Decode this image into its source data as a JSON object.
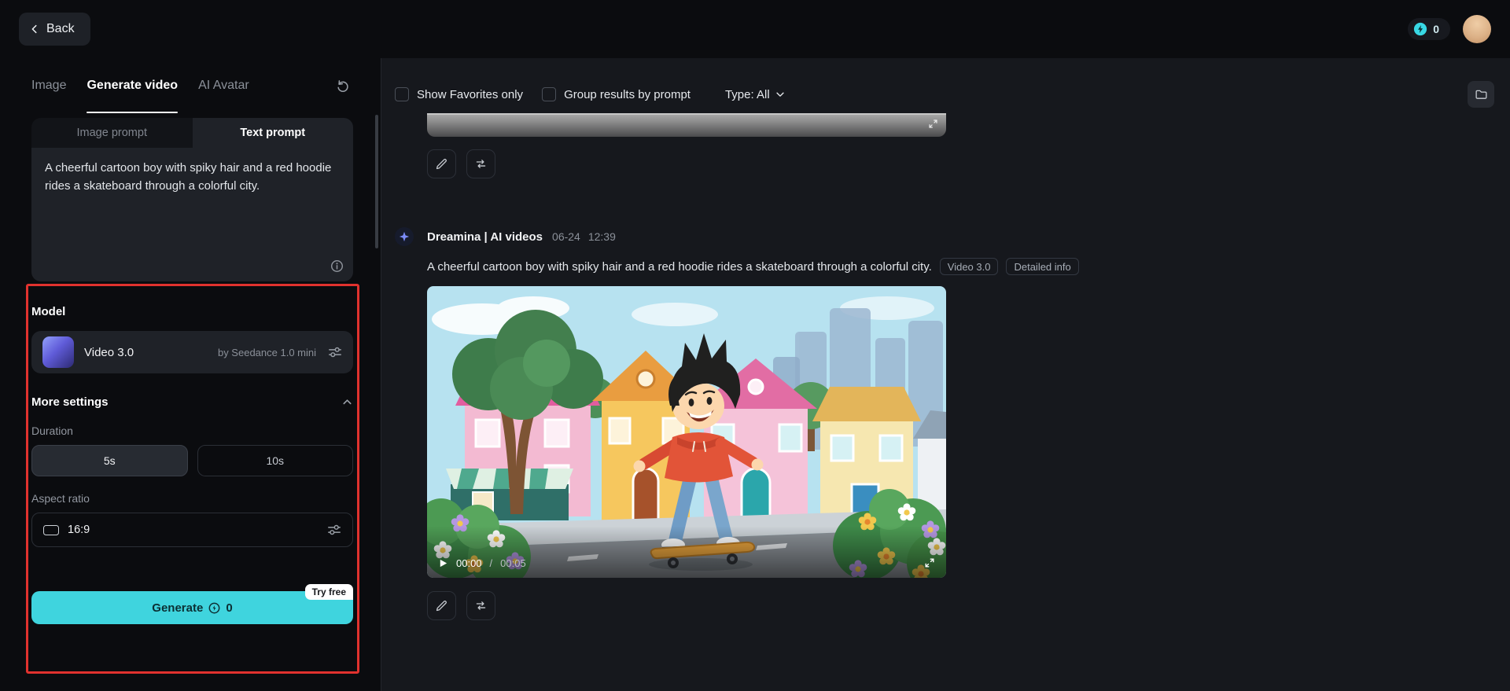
{
  "header": {
    "back_label": "Back",
    "credits_count": "0"
  },
  "sidebar": {
    "tabs": [
      {
        "label": "Image"
      },
      {
        "label": "Generate video"
      },
      {
        "label": "AI Avatar"
      }
    ],
    "prompt_mode": {
      "options": [
        "Image prompt",
        "Text prompt"
      ],
      "selected": "Text prompt"
    },
    "prompt_text": "A cheerful cartoon boy with spiky hair and a red hoodie rides a skateboard through a colorful city.",
    "model": {
      "section_label": "Model",
      "name": "Video 3.0",
      "provider": "by Seedance 1.0 mini"
    },
    "more_settings": {
      "label": "More settings",
      "duration_label": "Duration",
      "duration_options": [
        "5s",
        "10s"
      ],
      "duration_selected": "5s",
      "aspect_ratio_label": "Aspect ratio",
      "aspect_ratio_value": "16:9"
    },
    "generate": {
      "label": "Generate",
      "credits": "0",
      "badge": "Try free"
    }
  },
  "main": {
    "filters": {
      "favorites_label": "Show Favorites only",
      "group_label": "Group results by prompt",
      "type_label": "Type: All"
    },
    "result": {
      "author": "Dreamina | AI videos",
      "date": "06-24",
      "time": "12:39",
      "prompt": "A cheerful cartoon boy with spiky hair and a red hoodie rides a skateboard through a colorful city.",
      "badges": [
        "Video 3.0",
        "Detailed info"
      ],
      "player": {
        "current_time": "00:00",
        "separator": "/",
        "duration": "00:05"
      }
    }
  },
  "colors": {
    "accent": "#3fd4de",
    "annotation": "#e1322e"
  }
}
